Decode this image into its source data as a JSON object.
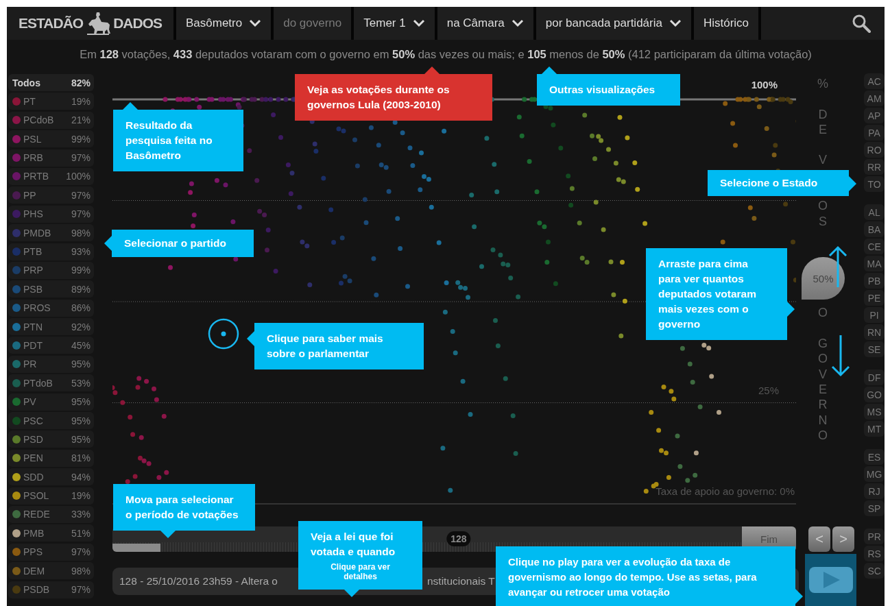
{
  "header": {
    "logo_left": "ESTADÃO",
    "logo_right": "DADOS",
    "nav": [
      {
        "label": "Basômetro",
        "dropdown": true,
        "disabled": false
      },
      {
        "label": "do governo",
        "dropdown": false,
        "disabled": true
      },
      {
        "label": "Temer 1",
        "dropdown": true,
        "disabled": false
      },
      {
        "label": "na Câmara",
        "dropdown": true,
        "disabled": false
      },
      {
        "label": "por bancada partidária",
        "dropdown": true,
        "disabled": false
      },
      {
        "label": "Histórico",
        "dropdown": false,
        "disabled": false
      }
    ]
  },
  "summary": "Em **128** votações, **433** deputados votaram com o governo em **50%** das vezes ou mais; e **105** menos de **50%** (412 participaram da última votação)",
  "parties": [
    {
      "kind": "all",
      "name": "Todos",
      "value": "82%",
      "selected": true
    },
    {
      "kind": "party",
      "name": "PT",
      "value": "19%",
      "color": "#8a1538",
      "selected": false
    },
    {
      "kind": "party",
      "name": "PCdoB",
      "value": "21%",
      "color": "#8c1548",
      "selected": false
    },
    {
      "kind": "party",
      "name": "PSL",
      "value": "99%",
      "color": "#8e1560",
      "selected": false
    },
    {
      "kind": "party",
      "name": "PRB",
      "value": "97%",
      "color": "#7e1566",
      "selected": false
    },
    {
      "kind": "party",
      "name": "PRTB",
      "value": "100%",
      "color": "#6a1566",
      "selected": false
    },
    {
      "kind": "party",
      "name": "PP",
      "value": "97%",
      "color": "#4a1a50",
      "selected": false
    },
    {
      "kind": "party",
      "name": "PHS",
      "value": "97%",
      "color": "#3c1a60",
      "selected": false
    },
    {
      "kind": "party",
      "name": "PMDB",
      "value": "98%",
      "color": "#2e2e6a",
      "selected": false
    },
    {
      "kind": "party",
      "name": "PTB",
      "value": "93%",
      "color": "#1a2e66",
      "selected": false
    },
    {
      "kind": "party",
      "name": "PRP",
      "value": "99%",
      "color": "#1a3c66",
      "selected": false
    },
    {
      "kind": "party",
      "name": "PSB",
      "value": "89%",
      "color": "#1a4a78",
      "selected": false
    },
    {
      "kind": "party",
      "name": "PROS",
      "value": "86%",
      "color": "#1a5a88",
      "selected": false
    },
    {
      "kind": "party",
      "name": "PTN",
      "value": "92%",
      "color": "#1a6e9a",
      "selected": false
    },
    {
      "kind": "party",
      "name": "PDT",
      "value": "45%",
      "color": "#1a6a80",
      "selected": false
    },
    {
      "kind": "party",
      "name": "PR",
      "value": "95%",
      "color": "#1a6a6a",
      "selected": false
    },
    {
      "kind": "party",
      "name": "PTdoB",
      "value": "53%",
      "color": "#1a5e50",
      "selected": false
    },
    {
      "kind": "party",
      "name": "PV",
      "value": "95%",
      "color": "#1a6a30",
      "selected": false
    },
    {
      "kind": "party",
      "name": "PSC",
      "value": "95%",
      "color": "#124a20",
      "selected": false
    },
    {
      "kind": "party",
      "name": "PSD",
      "value": "95%",
      "color": "#5a7a2a",
      "selected": false
    },
    {
      "kind": "party",
      "name": "PEN",
      "value": "81%",
      "color": "#7a8a2a",
      "selected": false
    },
    {
      "kind": "party",
      "name": "SDD",
      "value": "94%",
      "color": "#b0a01a",
      "selected": false
    },
    {
      "kind": "party",
      "name": "PSOL",
      "value": "19%",
      "color": "#a88a10",
      "selected": false
    },
    {
      "kind": "party",
      "name": "REDE",
      "value": "33%",
      "color": "#3e6a40",
      "selected": false
    },
    {
      "kind": "party",
      "name": "PMB",
      "value": "51%",
      "color": "#b0a088",
      "selected": false
    },
    {
      "kind": "party",
      "name": "PPS",
      "value": "97%",
      "color": "#8a5a10",
      "selected": false
    },
    {
      "kind": "party",
      "name": "DEM",
      "value": "98%",
      "color": "#7a5a18",
      "selected": false
    },
    {
      "kind": "party",
      "name": "PSDB",
      "value": "97%",
      "color": "#4a3a10",
      "selected": false
    }
  ],
  "chart": {
    "top_label": "100%",
    "quarter_label": "25%",
    "axis_caption": "Taxa de apoio ao governo: 0%"
  },
  "vertical_label": [
    "%",
    "DE",
    "V",
    "OS",
    "O",
    "GOVERNO"
  ],
  "handle": {
    "label": "50%"
  },
  "state_groups": [
    [
      "AC",
      "AM",
      "AP",
      "PA",
      "RO",
      "RR",
      "TO"
    ],
    [
      "AL",
      "BA",
      "CE",
      "MA",
      "PB",
      "PE",
      "PI",
      "RN",
      "SE"
    ],
    [
      "DF",
      "GO",
      "MS",
      "MT"
    ],
    [
      "ES",
      "MG",
      "RJ",
      "SP"
    ],
    [
      "PR",
      "RS",
      "SC"
    ]
  ],
  "timeline": {
    "thumb": "128",
    "level": 0.55,
    "end_button": "Fim"
  },
  "step_buttons": [
    "<",
    ">"
  ],
  "vote_description": {
    "visible_start": "128 - 25/10/2016 23h59 - Altera o",
    "visible_end": "nstitucionais T"
  },
  "callouts": [
    {
      "text": "Resultado da pesquisa feita no Basômetro",
      "color": "#00bbf2"
    },
    {
      "text": "Veja as votações durante os governos Lula (2003-2010)",
      "color": "#d8332f"
    },
    {
      "text": "Outras visualizações",
      "color": "#00bbf2"
    },
    {
      "text": "Selecione o Estado",
      "color": "#00bbf2"
    },
    {
      "text": "Selecionar o partido",
      "color": "#00bbf2"
    },
    {
      "text": "Arraste para cima para ver quantos deputados votaram mais vezes com o governo",
      "color": "#00bbf2"
    },
    {
      "text": "Clique para saber mais sobre o parlamentar",
      "color": "#00bbf2"
    },
    {
      "text": "Mova  para selecionar o período de votações",
      "color": "#00bbf2"
    },
    {
      "text": "Veja a lei que foi votada e quando",
      "note": "Clique para ver detalhes",
      "color": "#00bbf2"
    },
    {
      "text": "Clique no play para ver a evolução da taxa de governismo ao longo do tempo. Use as setas, para avançar ou retrocer uma votação",
      "color": "#00bbf2"
    }
  ]
}
